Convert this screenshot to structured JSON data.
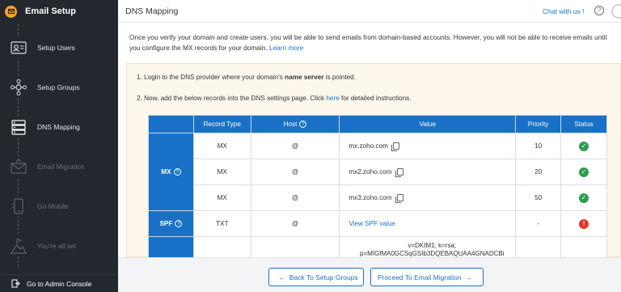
{
  "sidebar": {
    "brand_title": "Email Setup",
    "steps": [
      {
        "label": "Setup Users",
        "icon": "users-card-icon",
        "state": "done"
      },
      {
        "label": "Setup Groups",
        "icon": "group-network-icon",
        "state": "done"
      },
      {
        "label": "DNS Mapping",
        "icon": "dns-server-icon",
        "state": "active"
      },
      {
        "label": "Email Migration",
        "icon": "email-migration-icon",
        "state": "disabled"
      },
      {
        "label": "Go Mobile",
        "icon": "mobile-icon",
        "state": "disabled"
      },
      {
        "label": "You're all set",
        "icon": "flag-mountain-icon",
        "state": "disabled"
      }
    ],
    "admin_console_label": "Go to Admin Console"
  },
  "header": {
    "title": "DNS Mapping",
    "chat_label": "Chat with us !",
    "help_glyph": "?"
  },
  "intro": {
    "text": "Once you verify your domain and create users, you will be able to send emails from domain-based accounts. However, you will not be able to receive emails until you configure the MX records for your domain.",
    "learn_more": "Learn more"
  },
  "instructions": {
    "step1_prefix": "1. Login to the DNS provider where your domain's ",
    "step1_bold": "name server",
    "step1_suffix": " is pointed.",
    "step2_prefix": "2. Now, add the below records into the DNS settings page. Click ",
    "step2_link": "here",
    "step2_suffix": " for detailed instructions."
  },
  "table": {
    "headers": {
      "record_type": "Record Type",
      "host": "Host",
      "value": "Value",
      "priority": "Priority",
      "status": "Status"
    },
    "mx_label": "MX",
    "spf_label": "SPF",
    "mx_rows": [
      {
        "type": "MX",
        "host": "@",
        "value": "mx.zoho.com",
        "priority": "10",
        "status": "verified"
      },
      {
        "type": "MX",
        "host": "@",
        "value": "mx2.zoho.com",
        "priority": "20",
        "status": "verified"
      },
      {
        "type": "MX",
        "host": "@",
        "value": "mx3.zoho.com",
        "priority": "50",
        "status": "verified"
      }
    ],
    "spf_row": {
      "type": "TXT",
      "host": "@",
      "value": "View SPF value",
      "priority": "-",
      "status": "error"
    },
    "dkim_row": {
      "value_line1": "v=DKIM1; k=rsa;",
      "value_line2": "p=MIGfMA0GCSqGSIb3DQEBAQUAA4GNADCBi"
    },
    "check_glyph": "✓",
    "error_glyph": "!"
  },
  "footer": {
    "back_label": "Back To Setup Groups",
    "next_label": "Proceed To Email Migration"
  },
  "colors": {
    "accent": "#1971c7",
    "sidebar_bg": "#23272e",
    "success": "#2e9e4c",
    "error": "#e5322d",
    "panel_bg": "#fdf7ec"
  }
}
